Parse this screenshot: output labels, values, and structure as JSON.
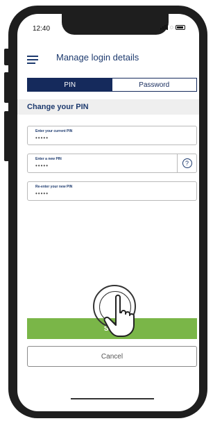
{
  "status_bar": {
    "time": "12:40"
  },
  "header": {
    "title": "Manage login details",
    "menu_icon": "hamburger-icon"
  },
  "tabs": [
    {
      "label": "PIN",
      "active": true
    },
    {
      "label": "Password",
      "active": false
    }
  ],
  "section": {
    "title": "Change your PIN"
  },
  "fields": {
    "current_pin": {
      "label": "Enter your current PIN",
      "value": "•••••"
    },
    "new_pin": {
      "label": "Enter a new PIN",
      "value": "•••••",
      "help_icon": "question-icon",
      "help_text": "?"
    },
    "reenter_pin": {
      "label": "Re-enter your new PIN",
      "value": "•••••"
    }
  },
  "buttons": {
    "save_label": "Save",
    "cancel_label": "Cancel"
  },
  "colors": {
    "primary": "#152a5c",
    "accent_green": "#7ab648",
    "section_bg": "#efefef"
  }
}
